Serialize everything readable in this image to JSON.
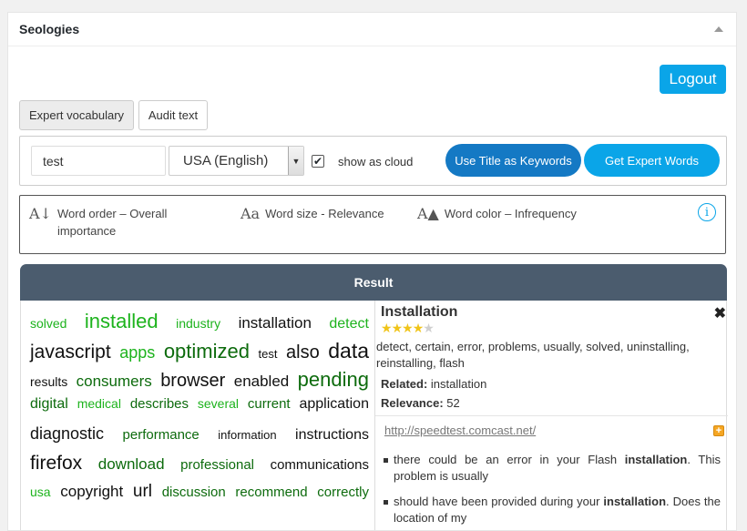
{
  "panel": {
    "title": "Seologies"
  },
  "auth": {
    "logout_label": "Logout"
  },
  "tabs": [
    {
      "label": "Expert vocabulary",
      "active": true
    },
    {
      "label": "Audit text",
      "active": false
    }
  ],
  "search": {
    "keyword_value": "test",
    "language_selected": "USA (English)",
    "show_as_cloud_checked": true,
    "show_as_cloud_label": "show as cloud",
    "use_title_label": "Use Title as Keywords",
    "get_expert_label": "Get Expert Words"
  },
  "legend": {
    "order": {
      "icon": "A↓",
      "text": "Word order – Overall importance"
    },
    "size": {
      "icon": "Aa",
      "text": "Word size - Relevance"
    },
    "color": {
      "icon": "A▲",
      "text": "Word color – Infrequency"
    },
    "info_icon": "info-icon"
  },
  "colors": {
    "green": "#1db31d",
    "dark_green": "#0d6b0d",
    "black": "#111111",
    "accent": "#0aa5e8",
    "result_header": "#4b5c6e"
  },
  "result": {
    "header": "Result",
    "cloud_lines": [
      [
        {
          "t": "solved",
          "s": 14,
          "c": "#1db31d"
        },
        {
          "t": "installed",
          "s": 22,
          "c": "#1db31d"
        },
        {
          "t": "industry",
          "s": 14,
          "c": "#1db31d"
        },
        {
          "t": "installation",
          "s": 17,
          "c": "#111111"
        },
        {
          "t": "detect",
          "s": 16,
          "c": "#1db31d"
        }
      ],
      [
        {
          "t": "javascript",
          "s": 21,
          "c": "#111111"
        },
        {
          "t": "apps",
          "s": 18,
          "c": "#1db31d"
        },
        {
          "t": "optimized",
          "s": 22,
          "c": "#0d6b0d"
        },
        {
          "t": "test",
          "s": 13,
          "c": "#111111"
        },
        {
          "t": "also",
          "s": 20,
          "c": "#111111"
        },
        {
          "t": "data",
          "s": 23,
          "c": "#111111"
        }
      ],
      [
        {
          "t": "results",
          "s": 14,
          "c": "#111111"
        },
        {
          "t": "consumers",
          "s": 17,
          "c": "#0d6b0d"
        },
        {
          "t": "browser",
          "s": 20,
          "c": "#111111"
        },
        {
          "t": "enabled",
          "s": 17,
          "c": "#111111"
        },
        {
          "t": "pending",
          "s": 22,
          "c": "#0d6b0d"
        }
      ],
      [
        {
          "t": "digital",
          "s": 16,
          "c": "#0d6b0d"
        },
        {
          "t": "medical",
          "s": 14,
          "c": "#1db31d"
        },
        {
          "t": "describes",
          "s": 15,
          "c": "#0d6b0d"
        },
        {
          "t": "several",
          "s": 14,
          "c": "#1db31d"
        },
        {
          "t": "current",
          "s": 15,
          "c": "#0d6b0d"
        },
        {
          "t": "application",
          "s": 16,
          "c": "#111111"
        }
      ],
      [
        {
          "t": "diagnostic",
          "s": 18,
          "c": "#111111"
        },
        {
          "t": "performance",
          "s": 15,
          "c": "#0d6b0d"
        },
        {
          "t": "information",
          "s": 13,
          "c": "#111111"
        },
        {
          "t": "instructions",
          "s": 16,
          "c": "#111111"
        }
      ],
      [
        {
          "t": "firefox",
          "s": 21,
          "c": "#111111"
        },
        {
          "t": "download",
          "s": 17,
          "c": "#0d6b0d"
        },
        {
          "t": "professional",
          "s": 15,
          "c": "#0d6b0d"
        },
        {
          "t": "communications",
          "s": 15,
          "c": "#111111"
        }
      ],
      [
        {
          "t": "usa",
          "s": 14,
          "c": "#1db31d"
        },
        {
          "t": "copyright",
          "s": 17,
          "c": "#111111"
        },
        {
          "t": "url",
          "s": 19,
          "c": "#111111"
        },
        {
          "t": "discussion",
          "s": 15,
          "c": "#0d6b0d"
        },
        {
          "t": "recommend",
          "s": 15,
          "c": "#0d6b0d"
        },
        {
          "t": "correctly",
          "s": 15,
          "c": "#0d6b0d"
        }
      ]
    ],
    "detail": {
      "title": "Installation",
      "stars_filled": 4,
      "stars_total": 5,
      "words": "detect, certain, error, problems, usually, solved, uninstalling, reinstalling, flash",
      "related_label": "Related:",
      "related_value": "installation",
      "relevance_label": "Relevance:",
      "relevance_value": "52",
      "source_url": "http://speedtest.comcast.net/",
      "snippets": [
        {
          "before": "there could be an error in your Flash ",
          "bold": "installation",
          "after": ". This problem is usually"
        },
        {
          "before": "should have been provided during your ",
          "bold": "installation",
          "after": ". Does the location of my"
        }
      ]
    }
  }
}
